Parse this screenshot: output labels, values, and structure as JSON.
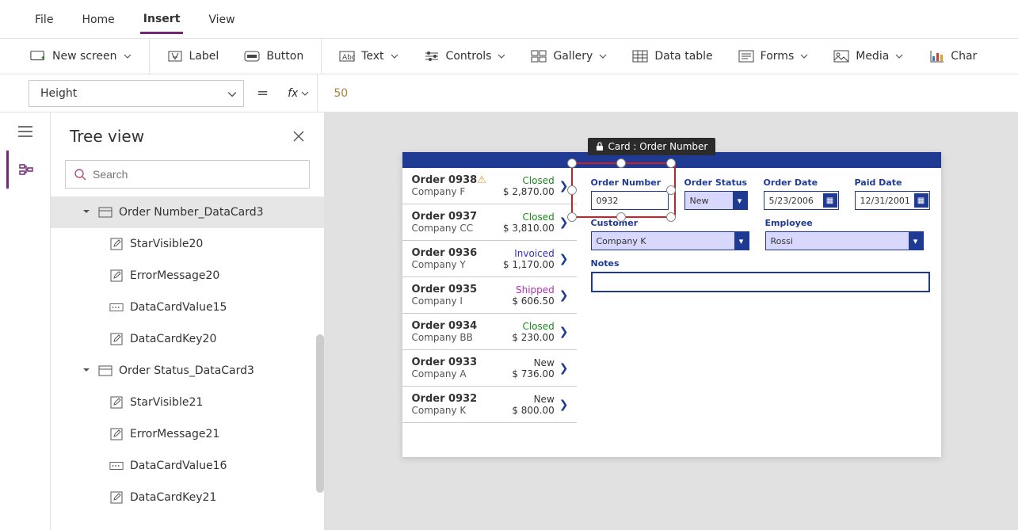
{
  "menu": {
    "file": "File",
    "home": "Home",
    "insert": "Insert",
    "view": "View"
  },
  "ribbon": {
    "new_screen": "New screen",
    "label": "Label",
    "button": "Button",
    "text": "Text",
    "controls": "Controls",
    "gallery": "Gallery",
    "data_table": "Data table",
    "forms": "Forms",
    "media": "Media",
    "chart": "Char"
  },
  "formula": {
    "property": "Height",
    "equals": "=",
    "fx": "fx",
    "value": "50"
  },
  "tree": {
    "title": "Tree view",
    "search_placeholder": "Search",
    "nodes": [
      {
        "label": "Order Number_DataCard3"
      },
      {
        "label": "StarVisible20"
      },
      {
        "label": "ErrorMessage20"
      },
      {
        "label": "DataCardValue15"
      },
      {
        "label": "DataCardKey20"
      },
      {
        "label": "Order Status_DataCard3"
      },
      {
        "label": "StarVisible21"
      },
      {
        "label": "ErrorMessage21"
      },
      {
        "label": "DataCardValue16"
      },
      {
        "label": "DataCardKey21"
      }
    ]
  },
  "canvas": {
    "tooltip": "Card : Order Number",
    "orders": [
      {
        "title": "Order 0938",
        "company": "Company F",
        "status": "Closed",
        "amount": "$ 2,870.00",
        "warn": true
      },
      {
        "title": "Order 0937",
        "company": "Company CC",
        "status": "Closed",
        "amount": "$ 3,810.00"
      },
      {
        "title": "Order 0936",
        "company": "Company Y",
        "status": "Invoiced",
        "amount": "$ 1,170.00"
      },
      {
        "title": "Order 0935",
        "company": "Company I",
        "status": "Shipped",
        "amount": "$ 606.50"
      },
      {
        "title": "Order 0934",
        "company": "Company BB",
        "status": "Closed",
        "amount": "$ 230.00"
      },
      {
        "title": "Order 0933",
        "company": "Company A",
        "status": "New",
        "amount": "$ 736.00"
      },
      {
        "title": "Order 0932",
        "company": "Company K",
        "status": "New",
        "amount": "$ 800.00"
      }
    ],
    "form": {
      "order_number_label": "Order Number",
      "order_number_value": "0932",
      "order_status_label": "Order Status",
      "order_status_value": "New",
      "order_date_label": "Order Date",
      "order_date_value": "5/23/2006",
      "paid_date_label": "Paid Date",
      "paid_date_value": "12/31/2001",
      "customer_label": "Customer",
      "customer_value": "Company K",
      "employee_label": "Employee",
      "employee_value": "Rossi",
      "notes_label": "Notes"
    }
  }
}
